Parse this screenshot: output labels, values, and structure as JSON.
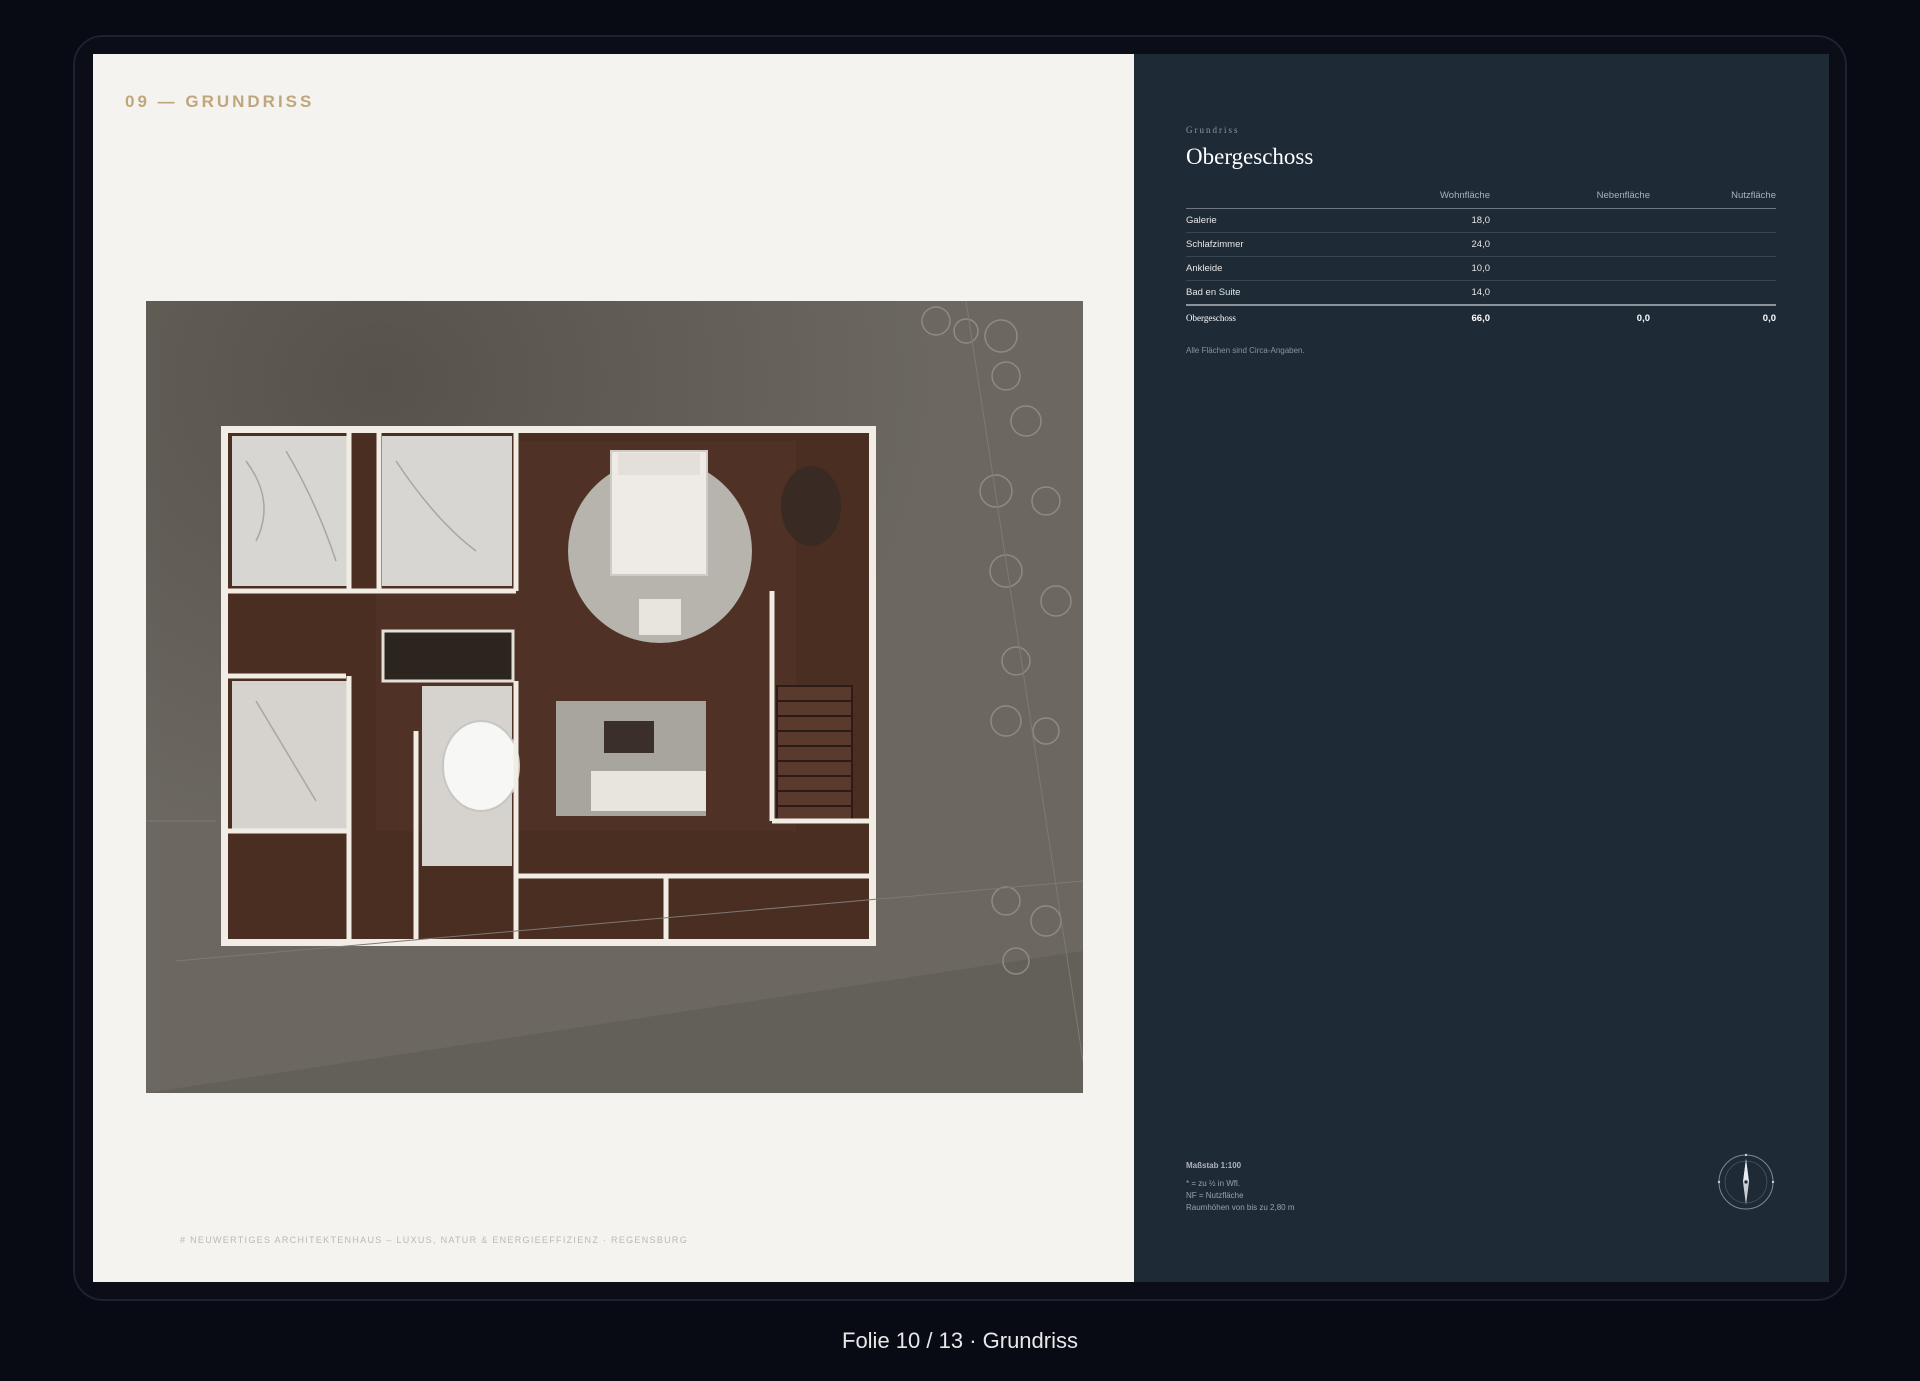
{
  "slide": {
    "section_label": "09 — GRUNDRISS",
    "footer_text": "# NEUWERTIGES ARCHITEKTENHAUS – LUXUS, NATUR & ENERGIEEFFIZIENZ · REGENSBURG",
    "plan_image": "floor-plan-render"
  },
  "panel": {
    "eyebrow": "Grundriss",
    "title": "Obergeschoss",
    "columns": [
      "",
      "Wohnfläche",
      "Nebenfläche",
      "Nutzfläche"
    ],
    "rows": [
      {
        "room": "Galerie",
        "wohn": "18,0",
        "neben": "",
        "nutz": ""
      },
      {
        "room": "Schlafzimmer",
        "wohn": "24,0",
        "neben": "",
        "nutz": ""
      },
      {
        "room": "Ankleide",
        "wohn": "10,0",
        "neben": "",
        "nutz": ""
      },
      {
        "room": "Bad en Suite",
        "wohn": "14,0",
        "neben": "",
        "nutz": ""
      }
    ],
    "total": {
      "label": "Obergeschoss",
      "wohn": "66,0",
      "neben": "0,0",
      "nutz": "0,0"
    },
    "note": "Alle Flächen sind Circa-Angaben.",
    "scale_title": "Maßstab 1:100",
    "legend": [
      "* = zu ½ in Wfl.",
      "NF = Nutzfläche",
      "Raumhöhen von bis zu 2,80 m"
    ],
    "compass_icon": "compass-rose-icon"
  },
  "caption": "Folie 10 / 13 · Grundriss",
  "colors": {
    "accent_gold": "#c0a67c",
    "panel_navy": "#1f2a37",
    "slide_bg": "#f5f3f0",
    "page_bg": "#080a14"
  }
}
